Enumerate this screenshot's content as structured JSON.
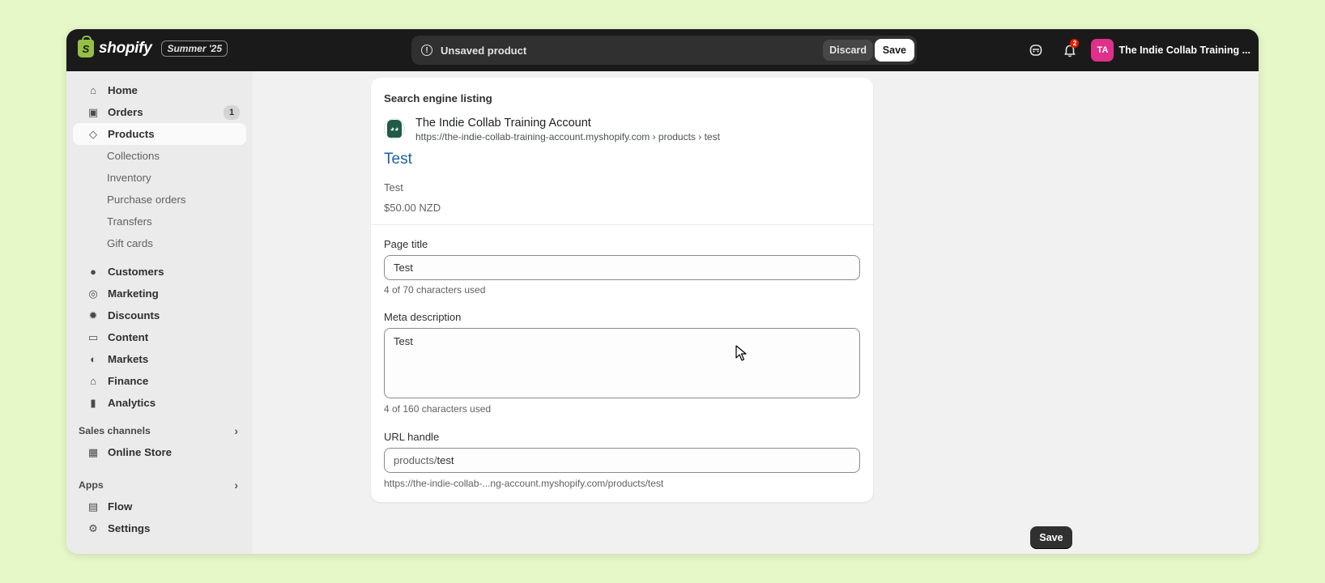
{
  "topbar": {
    "brand": "shopify",
    "edition": "Summer '25",
    "unsaved_message": "Unsaved product",
    "discard_label": "Discard",
    "save_label": "Save",
    "notification_count": "2",
    "avatar_initials": "TA",
    "store_name": "The Indie Collab Training ..."
  },
  "sidebar": {
    "items": [
      {
        "label": "Home",
        "icon": "home-icon"
      },
      {
        "label": "Orders",
        "icon": "inbox-icon",
        "badge": "1"
      },
      {
        "label": "Products",
        "icon": "tag-icon"
      }
    ],
    "product_subitems": [
      "Collections",
      "Inventory",
      "Purchase orders",
      "Transfers",
      "Gift cards"
    ],
    "items2": [
      {
        "label": "Customers",
        "icon": "person-icon"
      },
      {
        "label": "Marketing",
        "icon": "target-icon"
      },
      {
        "label": "Discounts",
        "icon": "discount-icon"
      },
      {
        "label": "Content",
        "icon": "content-icon"
      },
      {
        "label": "Markets",
        "icon": "globe-icon"
      },
      {
        "label": "Finance",
        "icon": "bank-icon"
      },
      {
        "label": "Analytics",
        "icon": "bar-chart-icon"
      }
    ],
    "sales_channels_label": "Sales channels",
    "online_store_label": "Online Store",
    "apps_label": "Apps",
    "flow_label": "Flow",
    "settings_label": "Settings"
  },
  "seo": {
    "heading": "Search engine listing",
    "store_name": "The Indie Collab Training Account",
    "url": "https://the-indie-collab-training-account.myshopify.com › products › test",
    "link_title": "Test",
    "description": "Test",
    "price": "$50.00 NZD"
  },
  "form": {
    "page_title_label": "Page title",
    "page_title_value": "Test",
    "page_title_help": "4 of 70 characters used",
    "meta_label": "Meta description",
    "meta_value": "Test",
    "meta_help": "4 of 160 characters used",
    "url_label": "URL handle",
    "url_prefix": "products/",
    "url_value": "test",
    "url_help": "https://the-indie-collab-...ng-account.myshopify.com/products/test"
  },
  "bottom": {
    "save_label": "Save"
  },
  "colors": {
    "topbar": "#1a1a1a",
    "background": "#e6f7c8",
    "link": "#1a5fa8",
    "avatar": "#e0318a"
  }
}
